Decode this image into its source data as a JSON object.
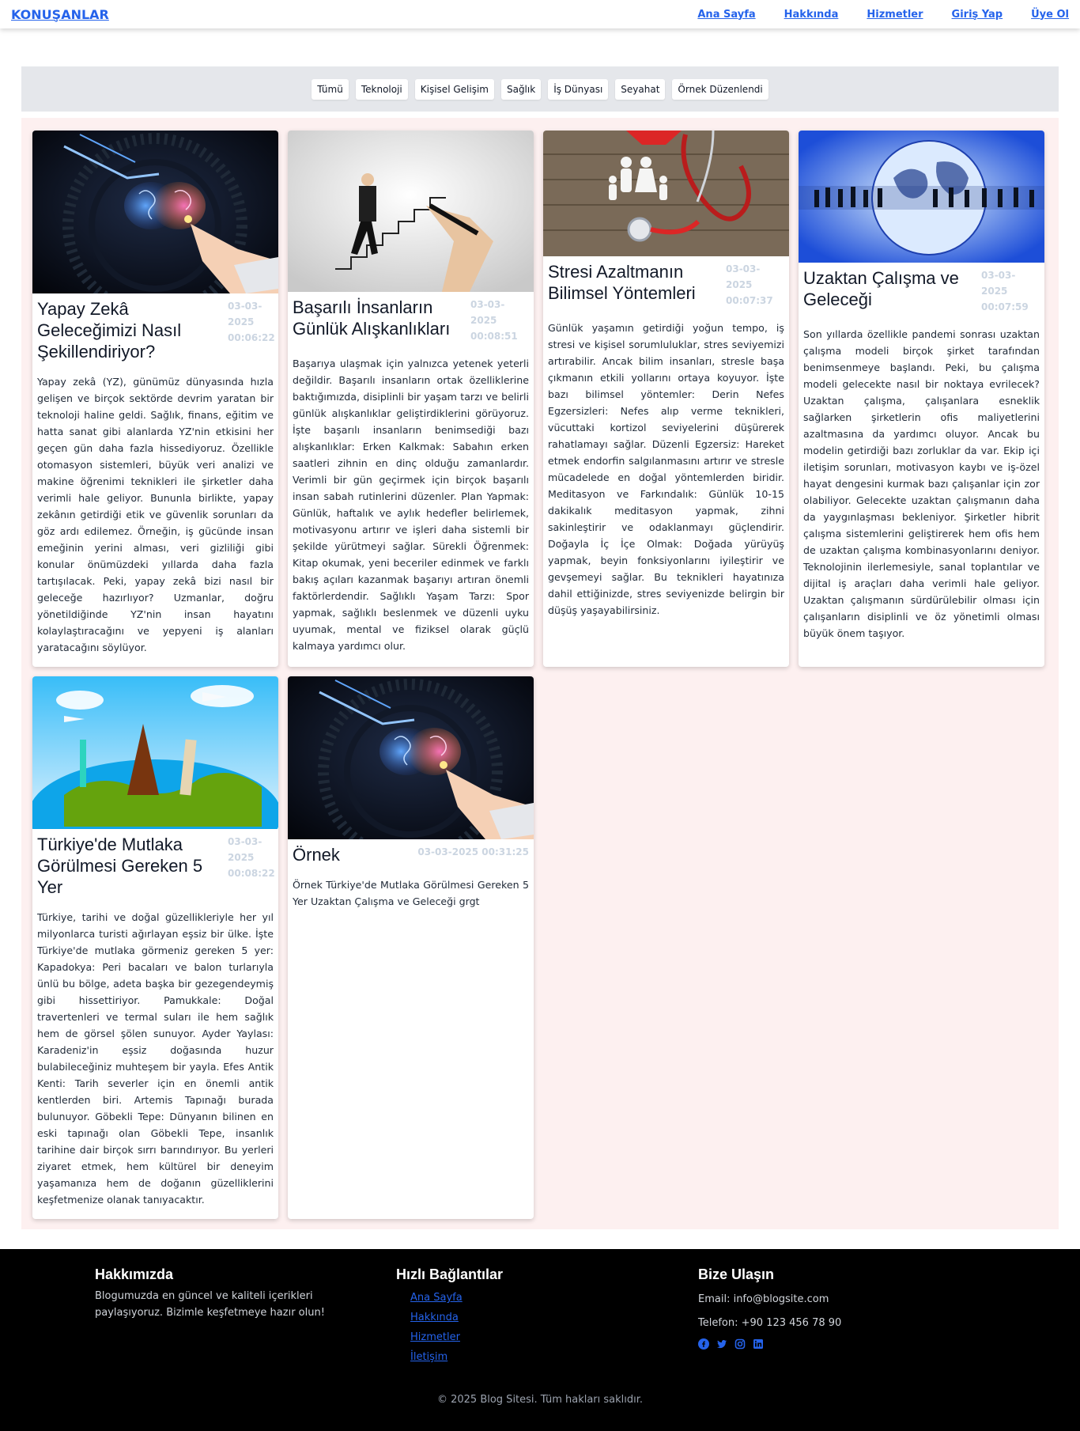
{
  "header": {
    "brand": "KONUŞANLAR",
    "nav": [
      "Ana Sayfa",
      "Hakkında",
      "Hizmetler",
      "Giriş Yap",
      "Üye Ol"
    ]
  },
  "filters": [
    "Tümü",
    "Teknoloji",
    "Kişisel Gelişim",
    "Sağlık",
    "İş Dünyası",
    "Seyahat",
    "Örnek Düzenlendi"
  ],
  "posts": [
    {
      "title": "Yapay Zekâ Geleceğimizi Nasıl Şekillendiriyor?",
      "date": "03-03-2025 00:06:22",
      "image": "ai-brain-image",
      "text": "Yapay zekâ (YZ), günümüz dünyasında hızla gelişen ve birçok sektörde devrim yaratan bir teknoloji haline geldi. Sağlık, finans, eğitim ve hatta sanat gibi alanlarda YZ'nin etkisini her geçen gün daha fazla hissediyoruz. Özellikle otomasyon sistemleri, büyük veri analizi ve makine öğrenimi teknikleri ile şirketler daha verimli hale geliyor. Bununla birlikte, yapay zekânın getirdiği etik ve güvenlik sorunları da göz ardı edilemez. Örneğin, iş gücünde insan emeğinin yerini alması, veri gizliliği gibi konular önümüzdeki yıllarda daha fazla tartışılacak. Peki, yapay zekâ bizi nasıl bir geleceğe hazırlıyor? Uzmanlar, doğru yönetildiğinde YZ'nin insan hayatını kolaylaştıracağını ve yepyeni iş alanları yaratacağını söylüyor."
    },
    {
      "title": "Başarılı İnsanların Günlük Alışkanlıkları",
      "date": "03-03-2025 00:08:51",
      "image": "stairs-success-image",
      "text": "Başarıya ulaşmak için yalnızca yetenek yeterli değildir. Başarılı insanların ortak özelliklerine baktığımızda, disiplinli bir yaşam tarzı ve belirli günlük alışkanlıklar geliştirdiklerini görüyoruz. İşte başarılı insanların benimsediği bazı alışkanlıklar: Erken Kalkmak: Sabahın erken saatleri zihnin en dinç olduğu zamanlardır. Verimli bir gün geçirmek için birçok başarılı insan sabah rutinlerini düzenler. Plan Yapmak: Günlük, haftalık ve aylık hedefler belirlemek, motivasyonu artırır ve işleri daha sistemli bir şekilde yürütmeyi sağlar. Sürekli Öğrenmek: Kitap okumak, yeni beceriler edinmek ve farklı bakış açıları kazanmak başarıyı artıran önemli faktörlerdendir. Sağlıklı Yaşam Tarzı: Spor yapmak, sağlıklı beslenmek ve düzenli uyku uyumak, mental ve fiziksel olarak güçlü kalmaya yardımcı olur."
    },
    {
      "title": "Stresi Azaltmanın Bilimsel Yöntemleri",
      "date": "03-03-2025 00:07:37",
      "image": "family-stethoscope-image",
      "text": "Günlük yaşamın getirdiği yoğun tempo, iş stresi ve kişisel sorumluluklar, stres seviyemizi artırabilir. Ancak bilim insanları, stresle başa çıkmanın etkili yollarını ortaya koyuyor. İşte bazı bilimsel yöntemler: Derin Nefes Egzersizleri: Nefes alıp verme teknikleri, vücuttaki kortizol seviyelerini düşürerek rahatlamayı sağlar. Düzenli Egzersiz: Hareket etmek endorfin salgılanmasını artırır ve stresle mücadelede en doğal yöntemlerden biridir. Meditasyon ve Farkındalık: Günlük 10-15 dakikalık meditasyon yapmak, zihni sakinleştirir ve odaklanmayı güçlendirir. Doğayla İç İçe Olmak: Doğada yürüyüş yapmak, beyin fonksiyonlarını iyileştirir ve gevşemeyi sağlar. Bu teknikleri hayatınıza dahil ettiğinizde, stres seviyenizde belirgin bir düşüş yaşayabilirsiniz."
    },
    {
      "title": "Uzaktan Çalışma ve Geleceği",
      "date": "03-03-2025 00:07:59",
      "image": "globe-business-image",
      "text": "Son yıllarda özellikle pandemi sonrası uzaktan çalışma modeli birçok şirket tarafından benimsenmeye başlandı. Peki, bu çalışma modeli gelecekte nasıl bir noktaya evrilecek? Uzaktan çalışma, çalışanlara esneklik sağlarken şirketlerin ofis maliyetlerini azaltmasına da yardımcı oluyor. Ancak bu modelin getirdiği bazı zorluklar da var. Ekip içi iletişim sorunları, motivasyon kaybı ve iş-özel hayat dengesini kurmak bazı çalışanlar için zor olabiliyor. Gelecekte uzaktan çalışmanın daha da yaygınlaşması bekleniyor. Şirketler hibrit çalışma sistemlerini geliştirerek hem ofis hem de uzaktan çalışma kombinasyonlarını deniyor. Teknolojinin ilerlemesiyle, sanal toplantılar ve dijital iş araçları daha verimli hale geliyor. Uzaktan çalışmanın sürdürülebilir olması için çalışanların disiplinli ve öz yönetimli olması büyük önem taşıyor."
    },
    {
      "title": "Türkiye'de Mutlaka Görülmesi Gereken 5 Yer",
      "date": "03-03-2025 00:08:22",
      "image": "world-landmarks-image",
      "text": "Türkiye, tarihi ve doğal güzellikleriyle her yıl milyonlarca turisti ağırlayan eşsiz bir ülke. İşte Türkiye'de mutlaka görmeniz gereken 5 yer: Kapadokya: Peri bacaları ve balon turlarıyla ünlü bu bölge, adeta başka bir gezegendeymiş gibi hissettiriyor. Pamukkale: Doğal travertenleri ve termal suları ile hem sağlık hem de görsel şölen sunuyor. Ayder Yaylası: Karadeniz'in eşsiz doğasında huzur bulabileceğiniz muhteşem bir yayla. Efes Antik Kenti: Tarih severler için en önemli antik kentlerden biri. Artemis Tapınağı burada bulunuyor. Göbekli Tepe: Dünyanın bilinen en eski tapınağı olan Göbekli Tepe, insanlık tarihine dair birçok sırrı barındırıyor. Bu yerleri ziyaret etmek, hem kültürel bir deneyim yaşamanıza hem de doğanın güzelliklerini keşfetmenize olanak tanıyacaktır."
    },
    {
      "title": "Örnek",
      "date": "03-03-2025 00:31:25",
      "image": "ai-brain-image",
      "text": "Örnek Türkiye'de Mutlaka Görülmesi Gereken 5 Yer Uzaktan Çalışma ve Geleceği grgt"
    }
  ],
  "footer": {
    "about_title": "Hakkımızda",
    "about_text": "Blogumuzda en güncel ve kaliteli içerikleri paylaşıyoruz. Bizimle keşfetmeye hazır olun!",
    "links_title": "Hızlı Bağlantılar",
    "links": [
      "Ana Sayfa",
      "Hakkında",
      "Hizmetler",
      "İletişim"
    ],
    "contact_title": "Bize Ulaşın",
    "email": "Email: info@blogsite.com",
    "phone": "Telefon: +90 123 456 78 90",
    "socials": [
      "facebook-icon",
      "twitter-icon",
      "instagram-icon",
      "linkedin-icon"
    ],
    "copyright": "© 2025 Blog Sitesi. Tüm hakları saklıdır."
  },
  "colors": {
    "accent": "#2563eb",
    "grid_bg": "#fdf0f0",
    "filter_bg": "#e5e7eb",
    "footer_bg": "#000000"
  }
}
